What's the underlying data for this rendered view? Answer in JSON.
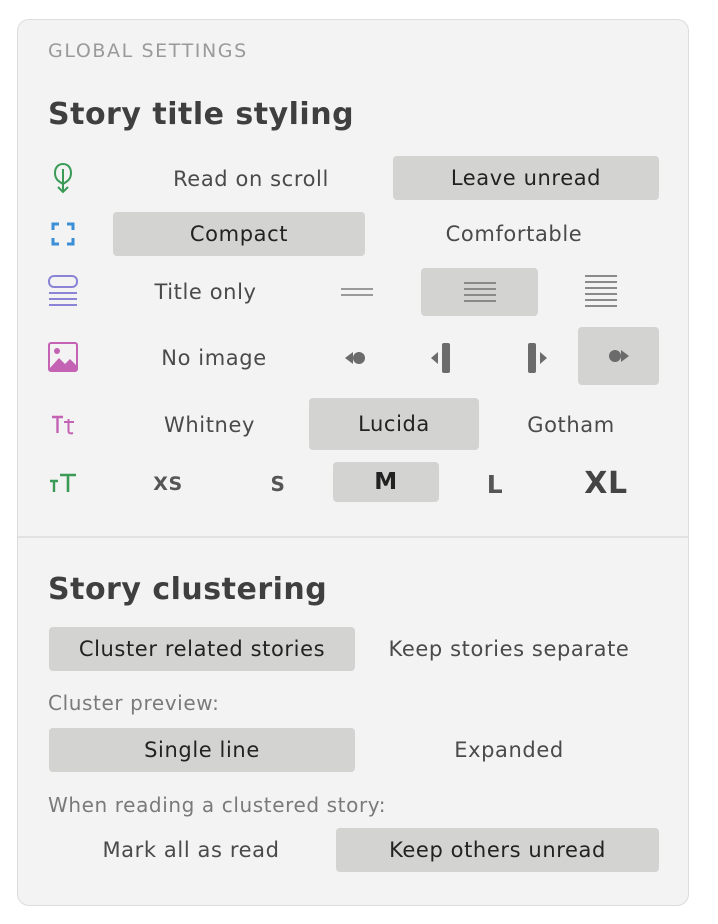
{
  "header": {
    "label": "GLOBAL SETTINGS"
  },
  "title_styling": {
    "title": "Story title styling",
    "read_mode": {
      "icon": "scroll-read-icon",
      "options": [
        "Read on scroll",
        "Leave unread"
      ],
      "selected": "Leave unread"
    },
    "density": {
      "icon": "compact-density-icon",
      "options": [
        "Compact",
        "Comfortable"
      ],
      "selected": "Compact"
    },
    "preview_lines": {
      "icon": "layout-lines-icon",
      "label": "Title only",
      "options": [
        "short-preview-icon",
        "medium-preview-icon",
        "long-preview-icon"
      ],
      "selected": "medium-preview-icon"
    },
    "image": {
      "icon": "image-icon",
      "label": "No image",
      "options": [
        "small-left-image-icon",
        "large-left-image-icon",
        "large-right-image-icon",
        "small-right-image-icon"
      ],
      "selected": "small-right-image-icon"
    },
    "font": {
      "icon": "font-family-icon",
      "options": [
        "Whitney",
        "Lucida",
        "Gotham"
      ],
      "selected": "Lucida"
    },
    "size": {
      "icon": "font-size-icon",
      "options": [
        "XS",
        "S",
        "M",
        "L",
        "XL"
      ],
      "selected": "M"
    }
  },
  "clustering": {
    "title": "Story clustering",
    "mode": {
      "options": [
        "Cluster related stories",
        "Keep stories separate"
      ],
      "selected": "Cluster related stories"
    },
    "preview_label": "Cluster preview:",
    "preview": {
      "options": [
        "Single line",
        "Expanded"
      ],
      "selected": "Single line"
    },
    "reading_label": "When reading a clustered story:",
    "reading": {
      "options": [
        "Mark all as read",
        "Keep others unread"
      ],
      "selected": "Keep others unread"
    }
  },
  "colors": {
    "panel_bg": "#f3f3f3",
    "selected_bg": "#d3d3d1",
    "green_icon": "#3a9a56",
    "blue_icon": "#3a8fd6",
    "purple_icon": "#8a84d6",
    "pink_icon": "#c463b4"
  }
}
